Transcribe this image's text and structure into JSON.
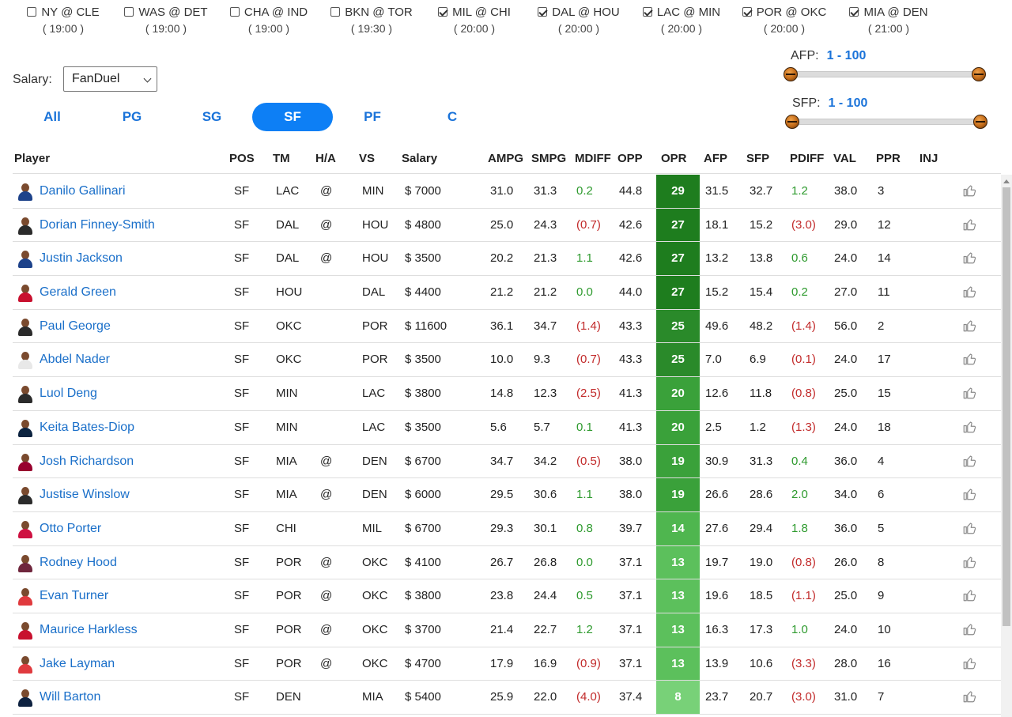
{
  "games": [
    {
      "label": "NY @ CLE",
      "time": "( 19:00 )",
      "checked": false
    },
    {
      "label": "WAS @ DET",
      "time": "( 19:00 )",
      "checked": false
    },
    {
      "label": "CHA @ IND",
      "time": "( 19:00 )",
      "checked": false
    },
    {
      "label": "BKN @ TOR",
      "time": "( 19:30 )",
      "checked": false
    },
    {
      "label": "MIL @ CHI",
      "time": "( 20:00 )",
      "checked": true
    },
    {
      "label": "DAL @ HOU",
      "time": "( 20:00 )",
      "checked": true
    },
    {
      "label": "LAC @ MIN",
      "time": "( 20:00 )",
      "checked": true
    },
    {
      "label": "POR @ OKC",
      "time": "( 20:00 )",
      "checked": true
    },
    {
      "label": "MIA @ DEN",
      "time": "( 21:00 )",
      "checked": true
    }
  ],
  "salary": {
    "label": "Salary:",
    "selected": "FanDuel"
  },
  "tabs": [
    {
      "label": "All",
      "active": false
    },
    {
      "label": "PG",
      "active": false
    },
    {
      "label": "SG",
      "active": false
    },
    {
      "label": "SF",
      "active": true
    },
    {
      "label": "PF",
      "active": false
    },
    {
      "label": "C",
      "active": false
    }
  ],
  "afp": {
    "label": "AFP:",
    "range": "1 - 100"
  },
  "sfp": {
    "label": "SFP:",
    "range": "1 - 100"
  },
  "columns": [
    "Player",
    "POS",
    "TM",
    "H/A",
    "VS",
    "Salary",
    "AMPG",
    "SMPG",
    "MDIFF",
    "OPP",
    "OPR",
    "AFP",
    "SFP",
    "PDIFF",
    "VAL",
    "PPR",
    "INJ"
  ],
  "players": [
    {
      "name": "Danilo Gallinari",
      "pos": "SF",
      "tm": "LAC",
      "ha": "@",
      "vs": "MIN",
      "salary": "$ 7000",
      "ampg": "31.0",
      "smpg": "31.3",
      "mdiff": "0.2",
      "opp": "44.8",
      "opr": "29",
      "afp": "31.5",
      "sfp": "32.7",
      "pdiff": "1.2",
      "val": "38.0",
      "ppr": "3",
      "inj": "",
      "jersey": "#1d428a"
    },
    {
      "name": "Dorian Finney-Smith",
      "pos": "SF",
      "tm": "DAL",
      "ha": "@",
      "vs": "HOU",
      "salary": "$ 4800",
      "ampg": "25.0",
      "smpg": "24.3",
      "mdiff": "(0.7)",
      "opp": "42.6",
      "opr": "27",
      "afp": "18.1",
      "sfp": "15.2",
      "pdiff": "(3.0)",
      "val": "29.0",
      "ppr": "12",
      "inj": "",
      "jersey": "#2b2b2b"
    },
    {
      "name": "Justin Jackson",
      "pos": "SF",
      "tm": "DAL",
      "ha": "@",
      "vs": "HOU",
      "salary": "$ 3500",
      "ampg": "20.2",
      "smpg": "21.3",
      "mdiff": "1.1",
      "opp": "42.6",
      "opr": "27",
      "afp": "13.2",
      "sfp": "13.8",
      "pdiff": "0.6",
      "val": "24.0",
      "ppr": "14",
      "inj": "",
      "jersey": "#1d428a"
    },
    {
      "name": "Gerald Green",
      "pos": "SF",
      "tm": "HOU",
      "ha": "",
      "vs": "DAL",
      "salary": "$ 4400",
      "ampg": "21.2",
      "smpg": "21.2",
      "mdiff": "0.0",
      "opp": "44.0",
      "opr": "27",
      "afp": "15.2",
      "sfp": "15.4",
      "pdiff": "0.2",
      "val": "27.0",
      "ppr": "11",
      "inj": "",
      "jersey": "#c8102e"
    },
    {
      "name": "Paul George",
      "pos": "SF",
      "tm": "OKC",
      "ha": "",
      "vs": "POR",
      "salary": "$ 11600",
      "ampg": "36.1",
      "smpg": "34.7",
      "mdiff": "(1.4)",
      "opp": "43.3",
      "opr": "25",
      "afp": "49.6",
      "sfp": "48.2",
      "pdiff": "(1.4)",
      "val": "56.0",
      "ppr": "2",
      "inj": "",
      "jersey": "#2b2b2b"
    },
    {
      "name": "Abdel Nader",
      "pos": "SF",
      "tm": "OKC",
      "ha": "",
      "vs": "POR",
      "salary": "$ 3500",
      "ampg": "10.0",
      "smpg": "9.3",
      "mdiff": "(0.7)",
      "opp": "43.3",
      "opr": "25",
      "afp": "7.0",
      "sfp": "6.9",
      "pdiff": "(0.1)",
      "val": "24.0",
      "ppr": "17",
      "inj": "",
      "jersey": "#e8e8e8"
    },
    {
      "name": "Luol Deng",
      "pos": "SF",
      "tm": "MIN",
      "ha": "",
      "vs": "LAC",
      "salary": "$ 3800",
      "ampg": "14.8",
      "smpg": "12.3",
      "mdiff": "(2.5)",
      "opp": "41.3",
      "opr": "20",
      "afp": "12.6",
      "sfp": "11.8",
      "pdiff": "(0.8)",
      "val": "25.0",
      "ppr": "15",
      "inj": "",
      "jersey": "#2b2b2b"
    },
    {
      "name": "Keita Bates-Diop",
      "pos": "SF",
      "tm": "MIN",
      "ha": "",
      "vs": "LAC",
      "salary": "$ 3500",
      "ampg": "5.6",
      "smpg": "5.7",
      "mdiff": "0.1",
      "opp": "41.3",
      "opr": "20",
      "afp": "2.5",
      "sfp": "1.2",
      "pdiff": "(1.3)",
      "val": "24.0",
      "ppr": "18",
      "inj": "",
      "jersey": "#0c2340"
    },
    {
      "name": "Josh Richardson",
      "pos": "SF",
      "tm": "MIA",
      "ha": "@",
      "vs": "DEN",
      "salary": "$ 6700",
      "ampg": "34.7",
      "smpg": "34.2",
      "mdiff": "(0.5)",
      "opp": "38.0",
      "opr": "19",
      "afp": "30.9",
      "sfp": "31.3",
      "pdiff": "0.4",
      "val": "36.0",
      "ppr": "4",
      "inj": "",
      "jersey": "#98002e"
    },
    {
      "name": "Justise Winslow",
      "pos": "SF",
      "tm": "MIA",
      "ha": "@",
      "vs": "DEN",
      "salary": "$ 6000",
      "ampg": "29.5",
      "smpg": "30.6",
      "mdiff": "1.1",
      "opp": "38.0",
      "opr": "19",
      "afp": "26.6",
      "sfp": "28.6",
      "pdiff": "2.0",
      "val": "34.0",
      "ppr": "6",
      "inj": "",
      "jersey": "#2b2b2b"
    },
    {
      "name": "Otto Porter",
      "pos": "SF",
      "tm": "CHI",
      "ha": "",
      "vs": "MIL",
      "salary": "$ 6700",
      "ampg": "29.3",
      "smpg": "30.1",
      "mdiff": "0.8",
      "opp": "39.7",
      "opr": "14",
      "afp": "27.6",
      "sfp": "29.4",
      "pdiff": "1.8",
      "val": "36.0",
      "ppr": "5",
      "inj": "",
      "jersey": "#ce1141"
    },
    {
      "name": "Rodney Hood",
      "pos": "SF",
      "tm": "POR",
      "ha": "@",
      "vs": "OKC",
      "salary": "$ 4100",
      "ampg": "26.7",
      "smpg": "26.8",
      "mdiff": "0.0",
      "opp": "37.1",
      "opr": "13",
      "afp": "19.7",
      "sfp": "19.0",
      "pdiff": "(0.8)",
      "val": "26.0",
      "ppr": "8",
      "inj": "",
      "jersey": "#6f263d"
    },
    {
      "name": "Evan Turner",
      "pos": "SF",
      "tm": "POR",
      "ha": "@",
      "vs": "OKC",
      "salary": "$ 3800",
      "ampg": "23.8",
      "smpg": "24.4",
      "mdiff": "0.5",
      "opp": "37.1",
      "opr": "13",
      "afp": "19.6",
      "sfp": "18.5",
      "pdiff": "(1.1)",
      "val": "25.0",
      "ppr": "9",
      "inj": "",
      "jersey": "#e03a3e"
    },
    {
      "name": "Maurice Harkless",
      "pos": "SF",
      "tm": "POR",
      "ha": "@",
      "vs": "OKC",
      "salary": "$ 3700",
      "ampg": "21.4",
      "smpg": "22.7",
      "mdiff": "1.2",
      "opp": "37.1",
      "opr": "13",
      "afp": "16.3",
      "sfp": "17.3",
      "pdiff": "1.0",
      "val": "24.0",
      "ppr": "10",
      "inj": "",
      "jersey": "#c8102e"
    },
    {
      "name": "Jake Layman",
      "pos": "SF",
      "tm": "POR",
      "ha": "@",
      "vs": "OKC",
      "salary": "$ 4700",
      "ampg": "17.9",
      "smpg": "16.9",
      "mdiff": "(0.9)",
      "opp": "37.1",
      "opr": "13",
      "afp": "13.9",
      "sfp": "10.6",
      "pdiff": "(3.3)",
      "val": "28.0",
      "ppr": "16",
      "inj": "",
      "jersey": "#e03a3e"
    },
    {
      "name": "Will Barton",
      "pos": "SF",
      "tm": "DEN",
      "ha": "",
      "vs": "MIA",
      "salary": "$ 5400",
      "ampg": "25.9",
      "smpg": "22.0",
      "mdiff": "(4.0)",
      "opp": "37.4",
      "opr": "8",
      "afp": "23.7",
      "sfp": "20.7",
      "pdiff": "(3.0)",
      "val": "31.0",
      "ppr": "7",
      "inj": "",
      "jersey": "#0e2240"
    }
  ],
  "colors": {
    "accent": "#0d7ff5",
    "link": "#1a6fc9",
    "positive": "#2e9a2e",
    "negative": "#c22b2b",
    "opr_high": "#1e7d1e",
    "opr_low": "#7ed67e"
  },
  "icons": {
    "row_action": "thumbs-up-icon",
    "slider_handle": "basketball-icon"
  }
}
